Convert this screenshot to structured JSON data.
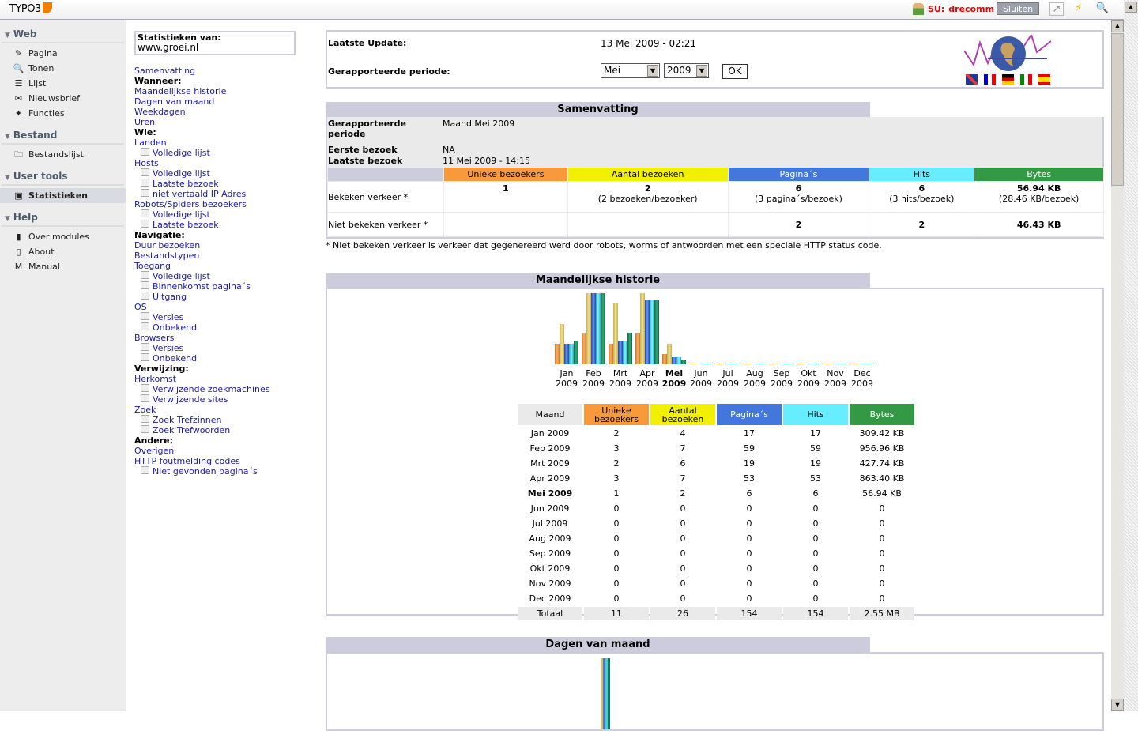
{
  "topbar": {
    "logo": "TYPO3",
    "su_label": "SU:",
    "user": "drecomm",
    "close_label": "Sluiten"
  },
  "sidebar": {
    "sections": [
      {
        "title": "Web",
        "items": [
          {
            "label": "Pagina",
            "icon": "page-edit-icon"
          },
          {
            "label": "Tonen",
            "icon": "magnifier-icon"
          },
          {
            "label": "Lijst",
            "icon": "list-icon"
          },
          {
            "label": "Nieuwsbrief",
            "icon": "envelope-icon"
          },
          {
            "label": "Functies",
            "icon": "wand-icon"
          }
        ]
      },
      {
        "title": "Bestand",
        "items": [
          {
            "label": "Bestandslijst",
            "icon": "filelist-icon"
          }
        ]
      },
      {
        "title": "User tools",
        "items": [
          {
            "label": "Statistieken",
            "icon": "camera-icon",
            "active": true
          }
        ]
      },
      {
        "title": "Help",
        "items": [
          {
            "label": "Over modules",
            "icon": "book-icon"
          },
          {
            "label": "About",
            "icon": "about-icon"
          },
          {
            "label": "Manual",
            "icon": "manual-icon"
          }
        ]
      }
    ]
  },
  "nav": {
    "site_label": "Statistieken van:",
    "site": "www.groei.nl",
    "items": [
      {
        "t": "link",
        "label": "Samenvatting"
      },
      {
        "t": "head",
        "label": "Wanneer:"
      },
      {
        "t": "link",
        "label": "Maandelijkse historie"
      },
      {
        "t": "link",
        "label": "Dagen van maand"
      },
      {
        "t": "link",
        "label": "Weekdagen"
      },
      {
        "t": "link",
        "label": "Uren"
      },
      {
        "t": "head",
        "label": "Wie:"
      },
      {
        "t": "link",
        "label": "Landen"
      },
      {
        "t": "sub",
        "label": "Volledige lijst"
      },
      {
        "t": "link",
        "label": "Hosts"
      },
      {
        "t": "sub",
        "label": "Volledige lijst"
      },
      {
        "t": "sub",
        "label": "Laatste bezoek"
      },
      {
        "t": "sub",
        "label": "niet vertaald IP Adres"
      },
      {
        "t": "link",
        "label": "Robots/Spiders bezoekers"
      },
      {
        "t": "sub",
        "label": "Volledige lijst"
      },
      {
        "t": "sub",
        "label": "Laatste bezoek"
      },
      {
        "t": "head",
        "label": "Navigatie:"
      },
      {
        "t": "link",
        "label": "Duur bezoeken"
      },
      {
        "t": "link",
        "label": "Bestandstypen"
      },
      {
        "t": "link",
        "label": "Toegang"
      },
      {
        "t": "sub",
        "label": "Volledige lijst"
      },
      {
        "t": "sub",
        "label": "Binnenkomst pagina´s"
      },
      {
        "t": "sub",
        "label": "Uitgang"
      },
      {
        "t": "link",
        "label": "OS"
      },
      {
        "t": "sub",
        "label": "Versies"
      },
      {
        "t": "sub",
        "label": "Onbekend"
      },
      {
        "t": "link",
        "label": "Browsers"
      },
      {
        "t": "sub",
        "label": "Versies"
      },
      {
        "t": "sub",
        "label": "Onbekend"
      },
      {
        "t": "head",
        "label": "Verwijzing:"
      },
      {
        "t": "link",
        "label": "Herkomst"
      },
      {
        "t": "sub",
        "label": "Verwijzende zoekmachines"
      },
      {
        "t": "sub",
        "label": "Verwijzende sites"
      },
      {
        "t": "link",
        "label": "Zoek"
      },
      {
        "t": "sub",
        "label": "Zoek Trefzinnen"
      },
      {
        "t": "sub",
        "label": "Zoek Trefwoorden"
      },
      {
        "t": "head",
        "label": "Andere:"
      },
      {
        "t": "link",
        "label": "Overigen"
      },
      {
        "t": "link",
        "label": "HTTP foutmelding codes"
      },
      {
        "t": "sub",
        "label": "Niet gevonden pagina´s"
      }
    ]
  },
  "update": {
    "last_label": "Laatste Update:",
    "last_value": "13 Mei 2009 - 02:21",
    "period_label": "Gerapporteerde periode:",
    "month": "Mei",
    "year": "2009",
    "ok": "OK"
  },
  "colors": {
    "unique": "#f8993a",
    "visits": "#f0f000",
    "pages": "#4477dd",
    "hits": "#66eeff",
    "bytes": "#339944"
  },
  "summary": {
    "title": "Samenvatting",
    "period_label": "Gerapporteerde periode",
    "period_value": "Maand Mei 2009",
    "first_label": "Eerste bezoek",
    "first_value": "NA",
    "last_label": "Laatste bezoek",
    "last_value": "11 Mei 2009 - 14:15",
    "headers": [
      "Unieke bezoekers",
      "Aantal bezoeken",
      "Pagina´s",
      "Hits",
      "Bytes"
    ],
    "viewed_label": "Bekeken verkeer *",
    "viewed": [
      "1",
      "2",
      "6",
      "6",
      "56.94 KB"
    ],
    "viewed_sub": [
      "",
      "(2 bezoeken/bezoeker)",
      "(3 pagina´s/bezoek)",
      "(3 hits/bezoek)",
      "(28.46 KB/bezoek)"
    ],
    "notviewed_label": "Niet bekeken verkeer *",
    "notviewed": [
      "",
      "",
      "2",
      "2",
      "46.43 KB"
    ],
    "note": "* Niet bekeken verkeer is verkeer dat gegenereerd werd door robots, worms of antwoorden met een speciale HTTP status code."
  },
  "history": {
    "title": "Maandelijkse historie",
    "headers": [
      "Maand",
      "Unieke bezoekers",
      "Aantal bezoeken",
      "Pagina´s",
      "Hits",
      "Bytes"
    ],
    "rows": [
      [
        "Jan 2009",
        "2",
        "4",
        "17",
        "17",
        "309.42 KB"
      ],
      [
        "Feb 2009",
        "3",
        "7",
        "59",
        "59",
        "956.96 KB"
      ],
      [
        "Mrt 2009",
        "2",
        "6",
        "19",
        "19",
        "427.74 KB"
      ],
      [
        "Apr 2009",
        "3",
        "7",
        "53",
        "53",
        "863.40 KB"
      ],
      [
        "Mei 2009",
        "1",
        "2",
        "6",
        "6",
        "56.94 KB"
      ],
      [
        "Jun 2009",
        "0",
        "0",
        "0",
        "0",
        "0"
      ],
      [
        "Jul 2009",
        "0",
        "0",
        "0",
        "0",
        "0"
      ],
      [
        "Aug 2009",
        "0",
        "0",
        "0",
        "0",
        "0"
      ],
      [
        "Sep 2009",
        "0",
        "0",
        "0",
        "0",
        "0"
      ],
      [
        "Okt 2009",
        "0",
        "0",
        "0",
        "0",
        "0"
      ],
      [
        "Nov 2009",
        "0",
        "0",
        "0",
        "0",
        "0"
      ],
      [
        "Dec 2009",
        "0",
        "0",
        "0",
        "0",
        "0"
      ]
    ],
    "current": "Mei 2009",
    "total": [
      "Totaal",
      "11",
      "26",
      "154",
      "154",
      "2.55 MB"
    ]
  },
  "chart_data": {
    "type": "bar",
    "categories": [
      "Jan 2009",
      "Feb 2009",
      "Mrt 2009",
      "Apr 2009",
      "Mei 2009",
      "Jun 2009",
      "Jul 2009",
      "Aug 2009",
      "Sep 2009",
      "Okt 2009",
      "Nov 2009",
      "Dec 2009"
    ],
    "series": [
      {
        "name": "Unieke bezoekers",
        "values": [
          2,
          3,
          2,
          3,
          1,
          0,
          0,
          0,
          0,
          0,
          0,
          0
        ]
      },
      {
        "name": "Aantal bezoeken",
        "values": [
          4,
          7,
          6,
          7,
          2,
          0,
          0,
          0,
          0,
          0,
          0,
          0
        ]
      },
      {
        "name": "Pagina´s",
        "values": [
          17,
          59,
          19,
          53,
          6,
          0,
          0,
          0,
          0,
          0,
          0,
          0
        ]
      },
      {
        "name": "Hits",
        "values": [
          17,
          59,
          19,
          53,
          6,
          0,
          0,
          0,
          0,
          0,
          0,
          0
        ]
      },
      {
        "name": "Bytes",
        "values": [
          309.42,
          956.96,
          427.74,
          863.4,
          56.94,
          0,
          0,
          0,
          0,
          0,
          0,
          0
        ]
      }
    ]
  },
  "days": {
    "title": "Dagen van maand"
  }
}
